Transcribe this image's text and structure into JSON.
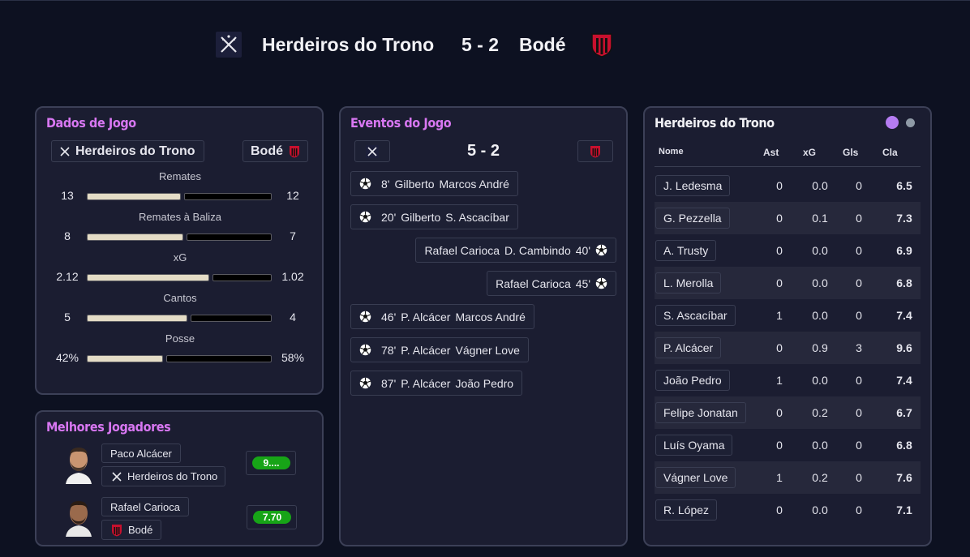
{
  "match": {
    "home_team": "Herdeiros do Trono",
    "away_team": "Bodé",
    "score": "5 - 2"
  },
  "colors": {
    "accent_title": "#d877f2",
    "bar_fill": "#e4dcc6",
    "rating_badge": "#17a417",
    "dot_home": "#b57cf2",
    "dot_away": "#8f9aa6"
  },
  "stats_panel": {
    "title": "Dados de Jogo",
    "home_label": "Herdeiros do Trono",
    "away_label": "Bodé",
    "stats": [
      {
        "label": "Remates",
        "home": "13",
        "away": "12",
        "home_share": 0.52
      },
      {
        "label": "Remates à Baliza",
        "home": "8",
        "away": "7",
        "home_share": 0.53
      },
      {
        "label": "xG",
        "home": "2.12",
        "away": "1.02",
        "home_share": 0.675
      },
      {
        "label": "Cantos",
        "home": "5",
        "away": "4",
        "home_share": 0.555
      },
      {
        "label": "Posse",
        "home": "42%",
        "away": "58%",
        "home_share": 0.42
      }
    ]
  },
  "events_panel": {
    "title": "Eventos do Jogo",
    "score": "5 - 2",
    "events": [
      {
        "side": "home",
        "minute": "8'",
        "scorer": "Gilberto",
        "assist": "Marcos André"
      },
      {
        "side": "home",
        "minute": "20'",
        "scorer": "Gilberto",
        "assist": "S. Ascacíbar"
      },
      {
        "side": "away",
        "minute": "40'",
        "scorer": "D. Cambindo",
        "assist": "Rafael Carioca"
      },
      {
        "side": "away",
        "minute": "45'",
        "scorer": "Rafael Carioca",
        "assist": ""
      },
      {
        "side": "home",
        "minute": "46'",
        "scorer": "P. Alcácer",
        "assist": "Marcos André"
      },
      {
        "side": "home",
        "minute": "78'",
        "scorer": "P. Alcácer",
        "assist": "Vágner Love"
      },
      {
        "side": "home",
        "minute": "87'",
        "scorer": "P. Alcácer",
        "assist": "João Pedro"
      }
    ]
  },
  "lineup_panel": {
    "title": "Herdeiros do Trono",
    "headers": {
      "name": "Nome",
      "ast": "Ast",
      "xg": "xG",
      "gls": "Gls",
      "cla": "Cla"
    },
    "players": [
      {
        "name": "J. Ledesma",
        "ast": "0",
        "xg": "0.0",
        "gls": "0",
        "cla": "6.5"
      },
      {
        "name": "G. Pezzella",
        "ast": "0",
        "xg": "0.1",
        "gls": "0",
        "cla": "7.3"
      },
      {
        "name": "A. Trusty",
        "ast": "0",
        "xg": "0.0",
        "gls": "0",
        "cla": "6.9"
      },
      {
        "name": "L. Merolla",
        "ast": "0",
        "xg": "0.0",
        "gls": "0",
        "cla": "6.8"
      },
      {
        "name": "S. Ascacíbar",
        "ast": "1",
        "xg": "0.0",
        "gls": "0",
        "cla": "7.4"
      },
      {
        "name": "P. Alcácer",
        "ast": "0",
        "xg": "0.9",
        "gls": "3",
        "cla": "9.6"
      },
      {
        "name": "João Pedro",
        "ast": "1",
        "xg": "0.0",
        "gls": "0",
        "cla": "7.4"
      },
      {
        "name": "Felipe Jonatan",
        "ast": "0",
        "xg": "0.2",
        "gls": "0",
        "cla": "6.7"
      },
      {
        "name": "Luís Oyama",
        "ast": "0",
        "xg": "0.0",
        "gls": "0",
        "cla": "6.8"
      },
      {
        "name": "Vágner Love",
        "ast": "1",
        "xg": "0.2",
        "gls": "0",
        "cla": "7.6"
      },
      {
        "name": "R. López",
        "ast": "0",
        "xg": "0.0",
        "gls": "0",
        "cla": "7.1"
      }
    ]
  },
  "best_panel": {
    "title": "Melhores Jogadores",
    "players": [
      {
        "name": "Paco Alcácer",
        "team": "Herdeiros do Trono",
        "rating": "9...."
      },
      {
        "name": "Rafael Carioca",
        "team": "Bodé",
        "rating": "7.70"
      }
    ]
  }
}
